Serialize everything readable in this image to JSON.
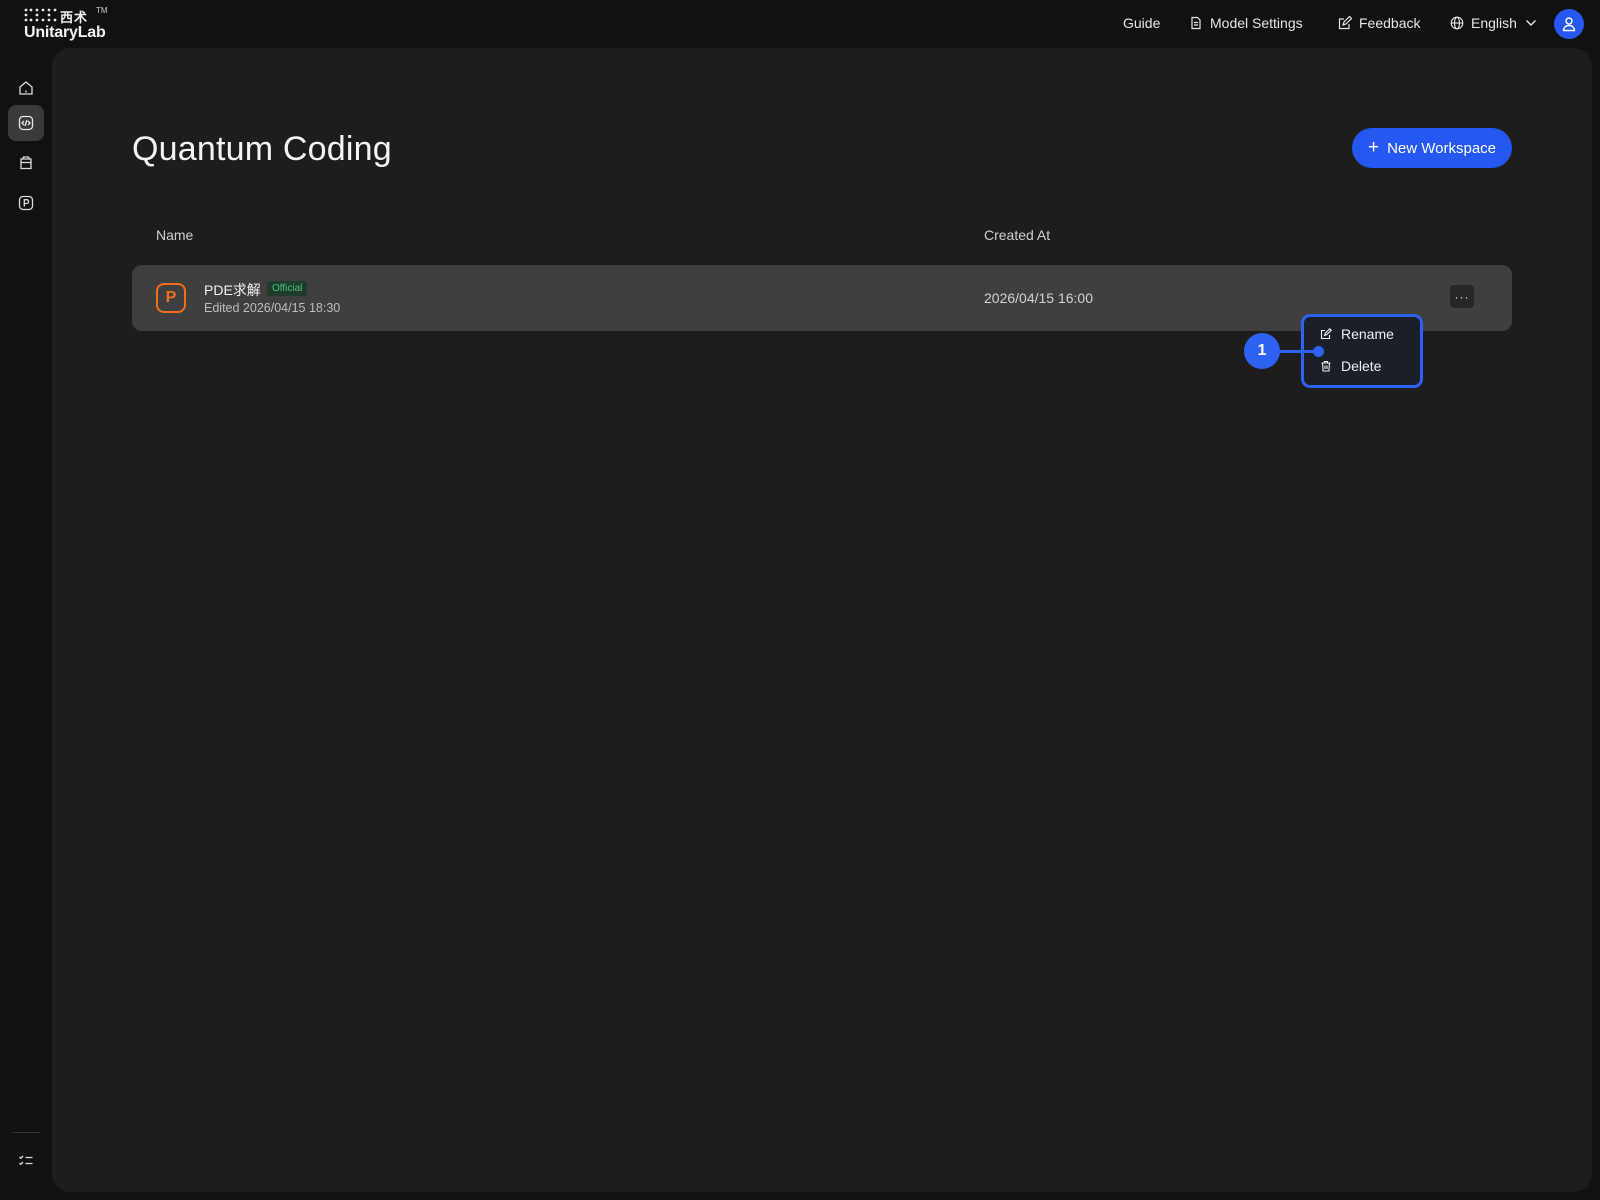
{
  "brand": {
    "logo_cn": "西术",
    "logo_tm": "TM",
    "logo_word": "UnitaryLab"
  },
  "topnav": {
    "guide": "Guide",
    "model_settings": "Model Settings",
    "feedback": "Feedback",
    "language": "English"
  },
  "sidebar": {
    "items": [
      {
        "icon": "home-icon",
        "active": false
      },
      {
        "icon": "code-icon",
        "active": true
      },
      {
        "icon": "database-icon",
        "active": false
      },
      {
        "icon": "p-badge-icon",
        "active": false
      }
    ],
    "bottom_icon": "task-list-icon"
  },
  "page": {
    "title": "Quantum Coding",
    "new_button": "New Workspace",
    "new_button_icon": "plus-icon"
  },
  "table": {
    "columns": [
      "Name",
      "Created At"
    ],
    "rows": [
      {
        "icon": "P",
        "name": "PDE求解",
        "badge": "Official",
        "edited": "Edited 2026/04/15 18:30",
        "created_at": "2026/04/15 16:00",
        "more": "···"
      }
    ]
  },
  "menu": {
    "rename": "Rename",
    "delete": "Delete"
  },
  "annotation": {
    "label": "1"
  },
  "colors": {
    "accent": "#2458f0",
    "workspace_icon": "#f26d1d",
    "official_badge_text": "#4cc37b",
    "background": "#111111",
    "panel": "#1d1d1d",
    "row": "#3f3f3f"
  }
}
